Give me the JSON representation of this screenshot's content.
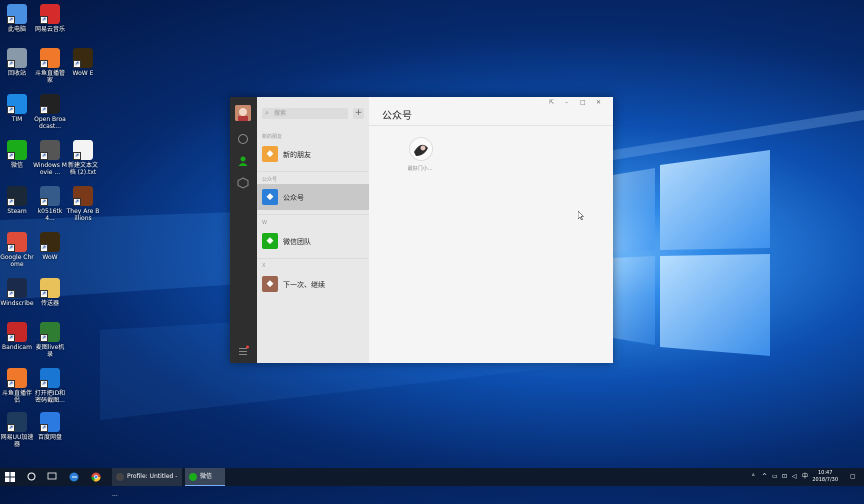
{
  "desktop": {
    "icons": [
      {
        "label": "此电脑",
        "icon": "computer-icon",
        "color": "#4a90e2"
      },
      {
        "label": "网易云音乐",
        "icon": "netease-music-icon",
        "color": "#d62b2b"
      },
      {
        "label": "回收站",
        "icon": "recycle-bin-icon",
        "color": "#8899aa"
      },
      {
        "label": "斗鱼直播管家",
        "icon": "douyu-icon",
        "color": "#f0782a"
      },
      {
        "label": "WoW E",
        "icon": "wow-icon",
        "color": "#3a2a10"
      },
      {
        "label": "TIM",
        "icon": "tim-icon",
        "color": "#1e88e5"
      },
      {
        "label": "Open Broadcast...",
        "icon": "obs-icon",
        "color": "#222222"
      },
      {
        "label": "微信",
        "icon": "wechat-icon",
        "color": "#1aad19"
      },
      {
        "label": "Windows Movie ...",
        "icon": "movie-maker-icon",
        "color": "#555555"
      },
      {
        "label": "新建文本文档 (2).txt",
        "icon": "text-file-icon",
        "color": "#f4f4f4"
      },
      {
        "label": "Steam",
        "icon": "steam-icon",
        "color": "#1b2838"
      },
      {
        "label": "k0516tk4...",
        "icon": "game-icon",
        "color": "#355b8a"
      },
      {
        "label": "They Are Billions",
        "icon": "they-are-billions-icon",
        "color": "#7a3a1a"
      },
      {
        "label": "Google Chrome",
        "icon": "chrome-icon",
        "color": "#dd4b39"
      },
      {
        "label": "WoW",
        "icon": "wow-icon",
        "color": "#3a2a10"
      },
      {
        "label": "Windscribe",
        "icon": "windscribe-icon",
        "color": "#1a2a4a"
      },
      {
        "label": "传送器",
        "icon": "folder-icon",
        "color": "#e8c15a"
      },
      {
        "label": "Bandicam",
        "icon": "bandicam-icon",
        "color": "#c62828"
      },
      {
        "label": "麦图live机录",
        "icon": "prof-icon",
        "color": "#2e7d32"
      },
      {
        "label": "斗鱼直播伴侣",
        "icon": "douyu-icon",
        "color": "#f0782a"
      },
      {
        "label": "打开把ID和密码截图...",
        "icon": "app-icon",
        "color": "#1976d2"
      },
      {
        "label": "网易UU加速器",
        "icon": "uu-icon",
        "color": "#1e3a5c"
      },
      {
        "label": "百度网盘",
        "icon": "baidu-netdisk-icon",
        "color": "#2a7ae2"
      }
    ]
  },
  "wechat": {
    "search_placeholder": "搜索",
    "add_label": "+",
    "main_title": "公众号",
    "controls": {
      "pin": "⇱",
      "min": "–",
      "max": "□",
      "close": "✕"
    },
    "sections": [
      {
        "header": "新的朋友",
        "items": [
          {
            "label": "新的朋友",
            "icon": "new-friend-icon",
            "color": "#f0a43a",
            "selected": false
          }
        ]
      },
      {
        "header": "公众号",
        "items": [
          {
            "label": "公众号",
            "icon": "official-account-icon",
            "color": "#2b7fd8",
            "selected": true
          }
        ]
      },
      {
        "header": "W",
        "items": [
          {
            "label": "微信团队",
            "icon": "wechat-team-icon",
            "color": "#1aad19",
            "selected": false
          }
        ]
      },
      {
        "header": "X",
        "items": [
          {
            "label": "下一次、继续",
            "icon": "contact-avatar-icon",
            "color": "#9c6550",
            "selected": false
          }
        ]
      }
    ],
    "official_account_name": "最好门小..."
  },
  "taskbar": {
    "apps": [
      {
        "label": "Profile: Untitled - ...",
        "icon": "obs-icon"
      },
      {
        "label": "微信",
        "icon": "wechat-icon"
      }
    ],
    "time": "10:47",
    "date": "2018/7/30",
    "ime": "中"
  }
}
